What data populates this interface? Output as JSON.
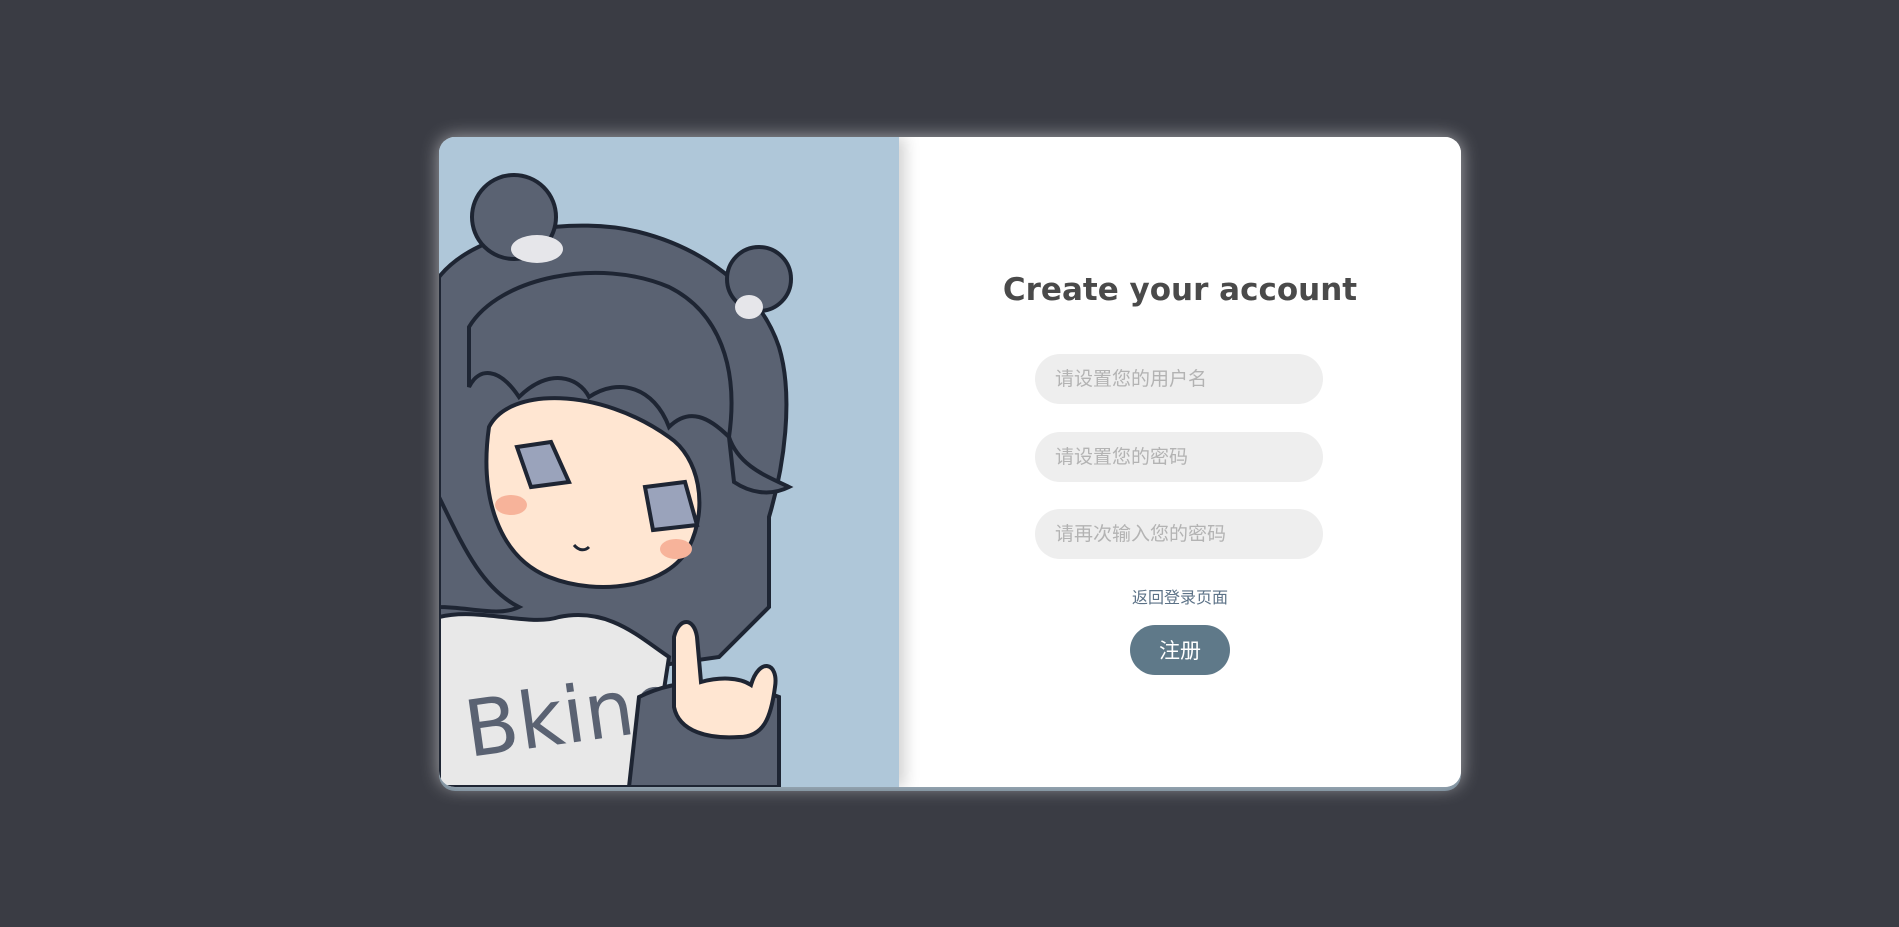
{
  "form": {
    "title": "Create your account",
    "username_placeholder": "请设置您的用户名",
    "password_placeholder": "请设置您的密码",
    "confirm_placeholder": "请再次输入您的密码",
    "back_to_login": "返回登录页面",
    "submit_label": "注册"
  },
  "illustration": {
    "name": "bear-hood-girl-illustration",
    "shirt_text": "Bking"
  },
  "colors": {
    "page_background": "#3a3c44",
    "art_background": "#afc7d9",
    "input_background": "#eeeeee",
    "button_background": "#5f7989",
    "title_color": "#4a4a4a",
    "link_color": "#5c7287"
  }
}
